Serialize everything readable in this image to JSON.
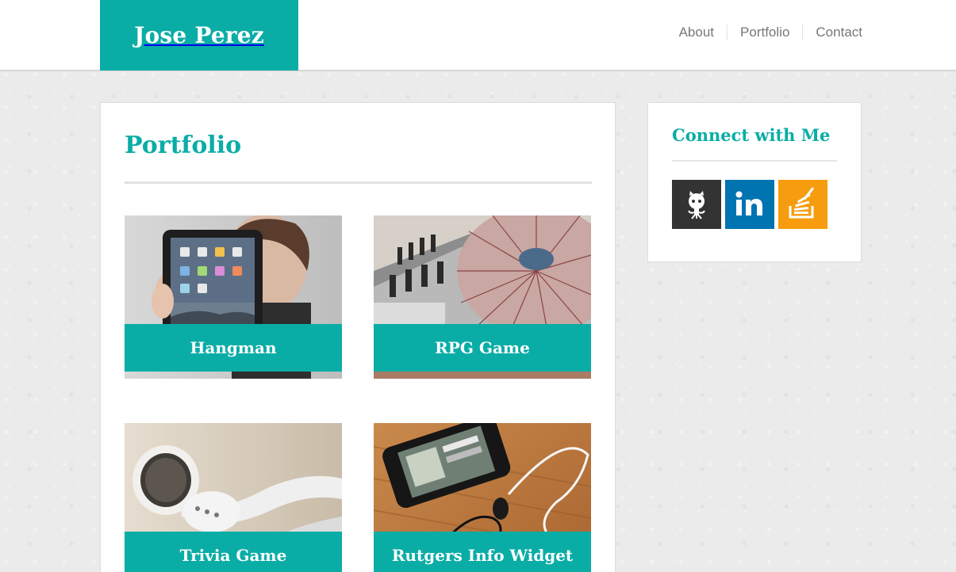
{
  "header": {
    "brand": "Jose Perez",
    "nav": [
      {
        "label": "About"
      },
      {
        "label": "Portfolio"
      },
      {
        "label": "Contact"
      }
    ]
  },
  "main": {
    "title": "Portfolio",
    "projects": [
      {
        "caption": "Hangman",
        "image": "ipad-photo"
      },
      {
        "caption": "RPG Game",
        "image": "dj-turntable-photo"
      },
      {
        "caption": "Trivia Game",
        "image": "earbuds-photo"
      },
      {
        "caption": "Rutgers Info Widget",
        "image": "iphone-earbuds-photo"
      }
    ]
  },
  "sidebar": {
    "title": "Connect with Me",
    "links": [
      {
        "icon": "github-icon",
        "color": "#333333"
      },
      {
        "icon": "linkedin-icon",
        "color": "#0073b1"
      },
      {
        "icon": "stackoverflow-icon",
        "color": "#f79c0e"
      }
    ]
  },
  "colors": {
    "accent": "#0aada6",
    "nav_text": "#777777",
    "background": "#ebebeb"
  }
}
